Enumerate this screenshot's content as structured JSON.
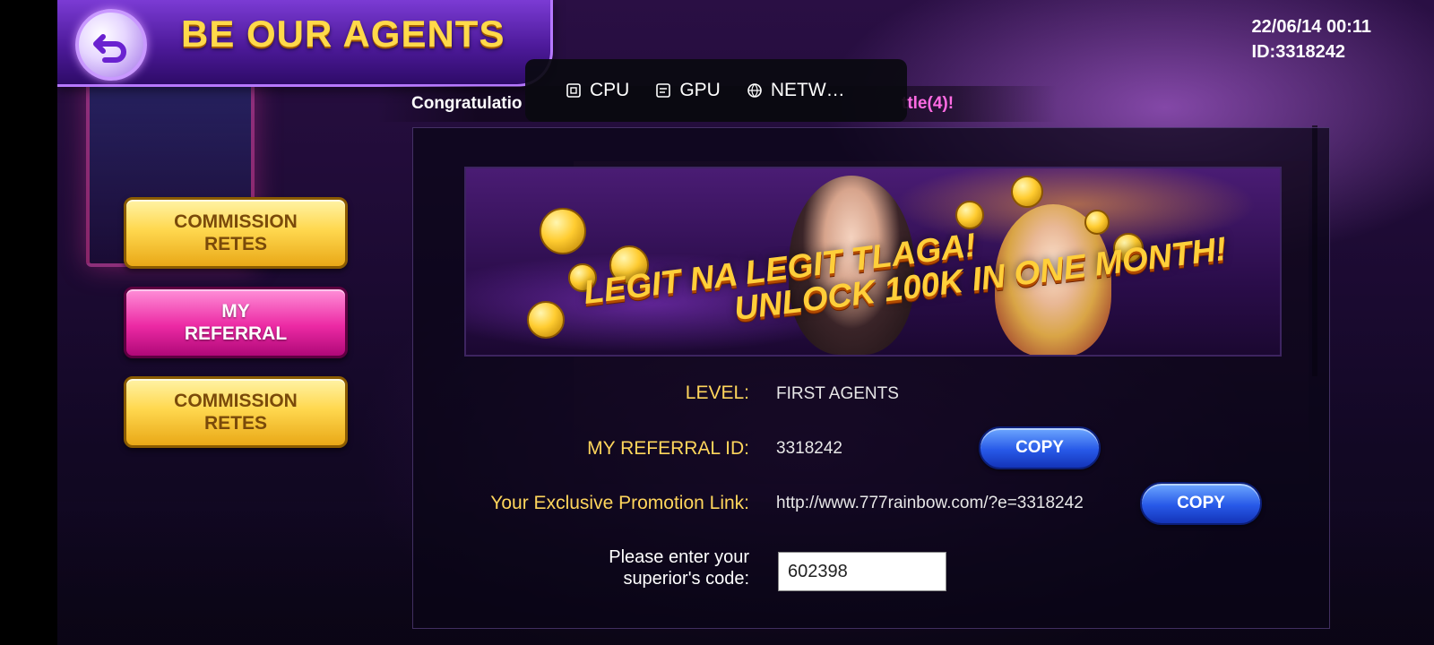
{
  "header": {
    "title": "BE OUR AGENTS",
    "back_icon": "back-arrow-icon"
  },
  "status": {
    "datetime": "22/06/14 00:11",
    "user_id": "ID:3318242"
  },
  "marquee": {
    "text_left": "Congratulatio",
    "text_right": "ttle(4)!"
  },
  "perf_overlay": {
    "items": [
      {
        "icon": "cpu-icon",
        "label": "CPU"
      },
      {
        "icon": "gpu-icon",
        "label": "GPU"
      },
      {
        "icon": "network-icon",
        "label": "NETW…"
      }
    ]
  },
  "sidebar": {
    "tabs": [
      {
        "line1": "COMMISSION",
        "line2": "RETES",
        "style": "gold"
      },
      {
        "line1": "MY",
        "line2": "REFERRAL",
        "style": "pink",
        "active": true
      },
      {
        "line1": "COMMISSION",
        "line2": "RETES",
        "style": "gold"
      }
    ]
  },
  "banner": {
    "line1": "LEGIT NA LEGIT TLAGA!",
    "line2": "UNLOCK 100K IN ONE MONTH!"
  },
  "info": {
    "level_label": "LEVEL:",
    "level_value": "FIRST AGENTS",
    "referral_label": "MY REFERRAL ID:",
    "referral_value": "3318242",
    "link_label": "Your Exclusive Promotion Link:",
    "link_value": "http://www.777rainbow.com/?e=3318242",
    "copy_label": "COPY",
    "superior_label_line1": "Please enter your",
    "superior_label_line2": "superior's code:",
    "superior_value": "602398"
  },
  "colors": {
    "gold": "#ffd94a",
    "pink": "#ec2aa4",
    "blue": "#2759e8",
    "purple": "#4d1a9a"
  }
}
